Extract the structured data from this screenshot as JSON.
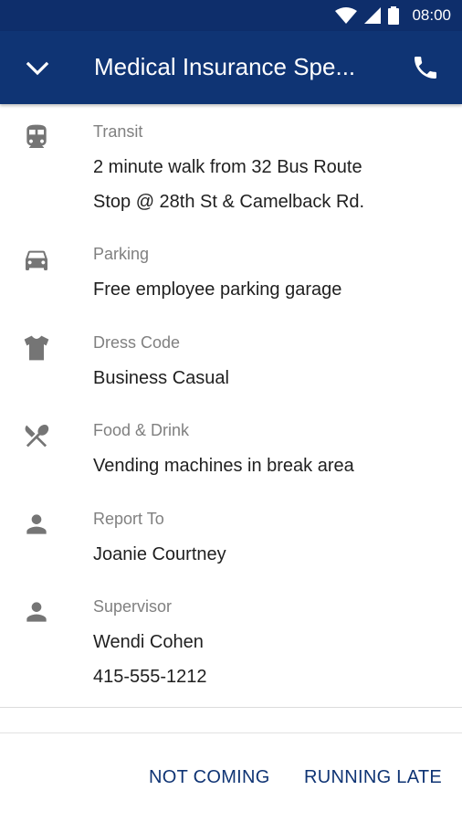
{
  "status_bar": {
    "time": "08:00"
  },
  "app_bar": {
    "title": "Medical Insurance Spe..."
  },
  "details": [
    {
      "label": "Transit",
      "icon": "train-icon",
      "value_lines": [
        "2 minute walk from 32 Bus Route",
        "Stop @ 28th St & Camelback Rd."
      ]
    },
    {
      "label": "Parking",
      "icon": "car-icon",
      "value_lines": [
        "Free employee parking garage"
      ]
    },
    {
      "label": "Dress Code",
      "icon": "shirt-icon",
      "value_lines": [
        "Business Casual"
      ]
    },
    {
      "label": "Food & Drink",
      "icon": "utensils-icon",
      "value_lines": [
        "Vending machines in break area"
      ]
    },
    {
      "label": "Report To",
      "icon": "person-icon",
      "value_lines": [
        "Joanie Courtney"
      ]
    },
    {
      "label": "Supervisor",
      "icon": "person-icon",
      "value_lines": [
        "Wendi Cohen",
        "415-555-1212"
      ]
    }
  ],
  "actions": {
    "not_coming": "NOT COMING",
    "running_late": "RUNNING LATE"
  },
  "colors": {
    "app_bar": "#0f3474",
    "status_bar": "#0e2e6b",
    "action_text": "#0f3474",
    "icon_gray": "#757575"
  }
}
